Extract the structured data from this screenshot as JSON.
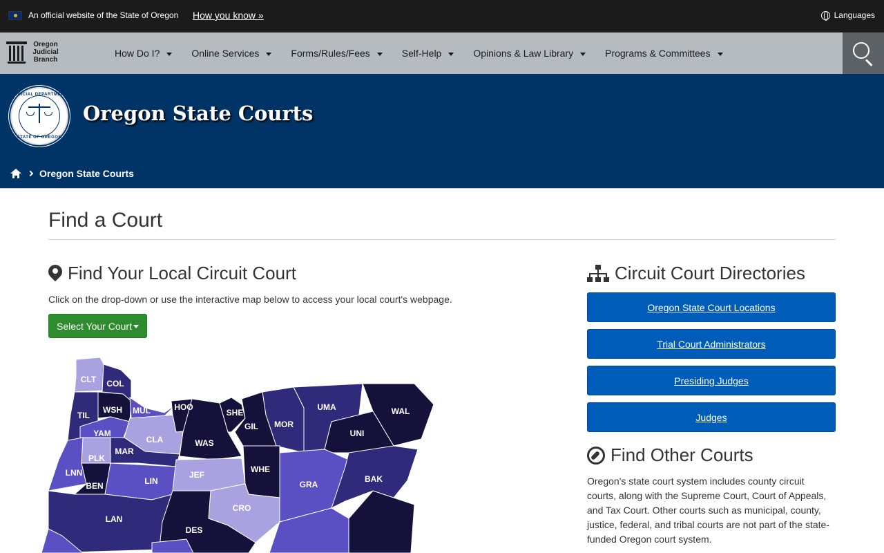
{
  "topbar": {
    "official_text": "An official website of the State of Oregon",
    "how_you_know": "How you know »",
    "languages": "Languages"
  },
  "nav": {
    "logo_text": "Oregon Judicial Branch",
    "items": [
      {
        "label": "How Do I?"
      },
      {
        "label": "Online Services"
      },
      {
        "label": "Forms/Rules/Fees"
      },
      {
        "label": "Self-Help"
      },
      {
        "label": "Opinions & Law Library"
      },
      {
        "label": "Programs & Committees"
      }
    ]
  },
  "hero": {
    "title": "Oregon State Courts",
    "seal_top": "JUDICIAL DEPARTMENT",
    "seal_bottom": "STATE OF OREGON",
    "breadcrumb_current": "Oregon State Courts"
  },
  "main": {
    "page_title": "Find a Court",
    "local": {
      "heading": "Find Your Local Circuit Court",
      "intro": "Click on the drop-down or use the interactive map below to access your local court's webpage.",
      "select_label": "Select Your Court"
    },
    "directories": {
      "heading": "Circuit Court Directories",
      "buttons": [
        {
          "label": "Oregon State Court Locations"
        },
        {
          "label": "Trial Court Administrators"
        },
        {
          "label": "Presiding Judges"
        },
        {
          "label": "Judges"
        }
      ]
    },
    "other": {
      "heading": "Find Other Courts",
      "text": "Oregon's state court system includes county circuit courts, along with the Supreme Court, Court of Appeals, and Tax Court. Other courts such as municipal, county, justice, federal, and tribal courts are not part of the state-funded Oregon court system."
    }
  },
  "map": {
    "counties": [
      "CLT",
      "COL",
      "WSH",
      "MUL",
      "HOO",
      "SHE",
      "GIL",
      "MOR",
      "UMA",
      "WAL",
      "TIL",
      "YAM",
      "CLA",
      "WAS",
      "UNI",
      "PLK",
      "MAR",
      "LNN",
      "LIN",
      "JEF",
      "WHE",
      "GRA",
      "BAK",
      "BEN",
      "CRO",
      "LAN",
      "DES"
    ],
    "colors": {
      "dark": "#14123a",
      "mid": "#2f2a7a",
      "light": "#5b4fc4",
      "pale": "#a8a3e0"
    }
  }
}
